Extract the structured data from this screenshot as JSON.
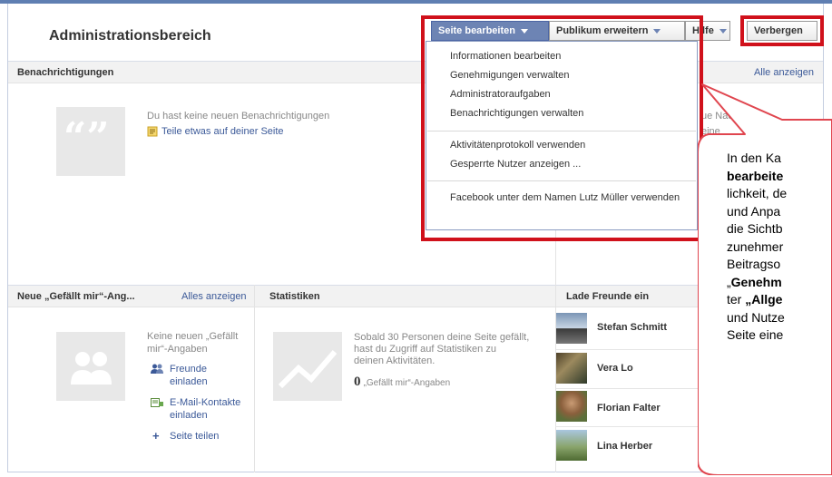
{
  "page": {
    "title": "Administrationsbereich"
  },
  "toolbar": {
    "edit_page_label": "Seite bearbeiten",
    "grow_audience_label": "Publikum erweitern",
    "help_label": "Hilfe",
    "hide_label": "Verbergen"
  },
  "dropdown": {
    "items": [
      "Informationen bearbeiten",
      "Genehmigungen verwalten",
      "Administratoraufgaben",
      "Benachrichtigungen verwalten",
      "Aktivitätenprotokoll verwenden",
      "Gesperrte Nutzer anzeigen ...",
      "Facebook unter dem Namen Lutz Müller verwenden"
    ]
  },
  "notifications": {
    "title": "Benachrichtigungen",
    "see_all": "Alle anzeigen",
    "empty_text": "Du hast keine neuen Benachrichtigungen",
    "share_link": "Teile etwas auf deiner Seite",
    "messages_fragment": "ue Nachrich",
    "messages_fragment2": "eine",
    "misc_fragment": "nzeig"
  },
  "likes": {
    "title": "Neue „Gefällt mir“-Ang...",
    "see_all": "Alles anzeigen",
    "empty_text_1": "Keine neuen „Gefällt",
    "empty_text_2": "mir“-Angaben",
    "invite_friends_1": "Freunde",
    "invite_friends_2": "einladen",
    "invite_email_1": "E-Mail-Kontakte",
    "invite_email_2": "einladen",
    "share_page": "Seite teilen"
  },
  "stats": {
    "title": "Statistiken",
    "info_1": "Sobald 30 Personen deine Seite gefällt,",
    "info_2": "hast du Zugriff auf Statistiken zu",
    "info_3": "deinen Aktivitäten.",
    "likes_count": "0",
    "likes_label": "„Gefällt mir“-Angaben"
  },
  "invite_friends": {
    "title": "Lade Freunde ein",
    "friends": [
      "Stefan Schmitt",
      "Vera Lo",
      "Florian Falter",
      "Lina Herber"
    ]
  },
  "callout": {
    "line1": "In den Ka",
    "line2": "bearbeite",
    "line3": "lichkeit, de",
    "line4": "und Anpa",
    "line5": "die Sichtb",
    "line6": "zunehmer",
    "line7": "Beitragso",
    "line8_quote": "„",
    "line8_bold": "Genehm",
    "line9_plain": "ter ",
    "line9_bold": "„Allge",
    "line10": "und Nutze",
    "line11": "Seite eine"
  },
  "colors": {
    "accent": "#6d84b4",
    "link": "#3b5998",
    "highlight_red": "#d0111b"
  }
}
